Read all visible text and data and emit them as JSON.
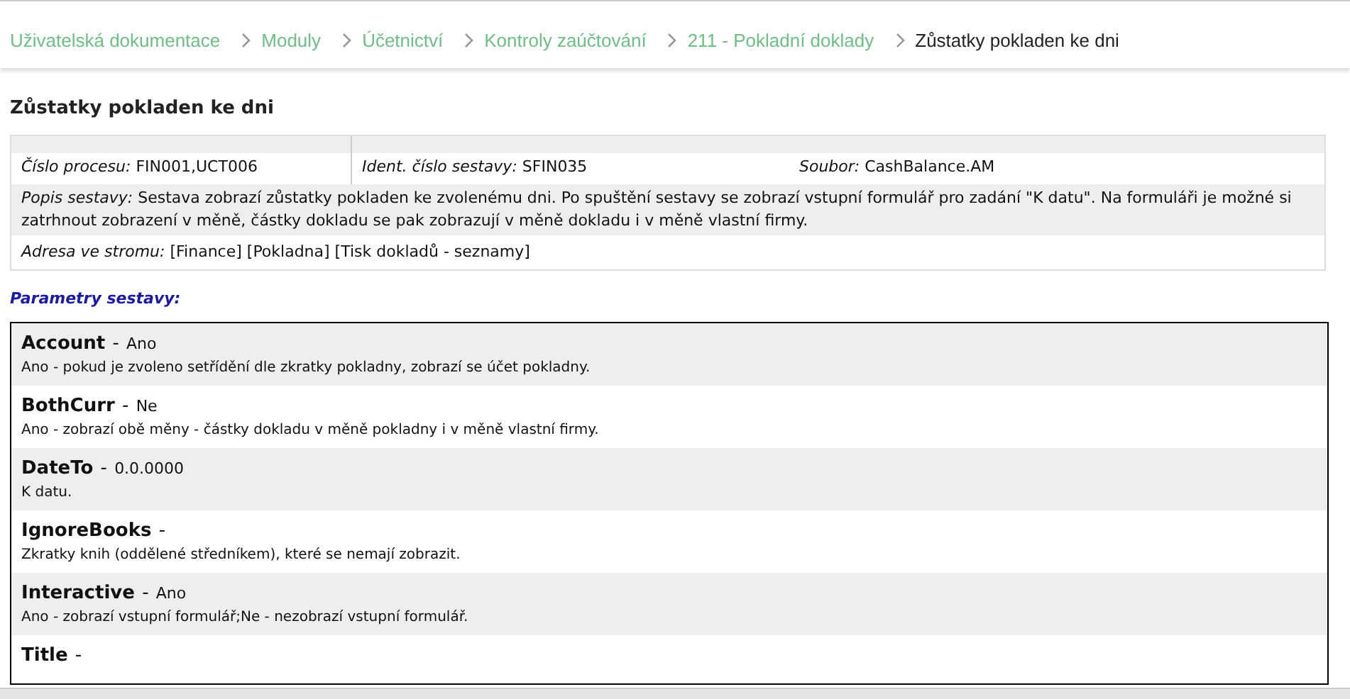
{
  "breadcrumb": [
    {
      "label": "Uživatelská dokumentace",
      "current": false
    },
    {
      "label": "Moduly",
      "current": false
    },
    {
      "label": "Účetnictví",
      "current": false
    },
    {
      "label": "Kontroly zaúčtování",
      "current": false
    },
    {
      "label": "211 - Pokladní doklady",
      "current": false
    },
    {
      "label": "Zůstatky pokladen ke dni",
      "current": true
    }
  ],
  "heading": "Zůstatky pokladen ke dni",
  "info": {
    "process_label": "Číslo procesu:",
    "process_value": "FIN001,UCT006",
    "ident_label": "Ident. číslo sestavy:",
    "ident_value": "SFIN035",
    "file_label": "Soubor:",
    "file_value": "CashBalance.AM",
    "description_label": "Popis sestavy:",
    "description": "Sestava zobrazí zůstatky pokladen ke zvolenému dni. Po spuštění sestavy se zobrazí vstupní formulář pro zadání \"K datu\". Na formuláři je možné si zatrhnout zobrazení v měně, částky dokladu se pak zobrazují v měně dokladu i v měně vlastní firmy.",
    "tree_label": "Adresa ve stromu:",
    "tree_value": "[Finance] [Pokladna] [Tisk dokladů - seznamy]"
  },
  "parameters_heading": "Parametry sestavy:",
  "parameters": [
    {
      "name": "Account",
      "separator": "-",
      "value": "Ano",
      "description": "Ano - pokud je zvoleno setřídění dle zkratky pokladny, zobrazí se účet pokladny."
    },
    {
      "name": "BothCurr",
      "separator": "-",
      "value": "Ne",
      "description": "Ano - zobrazí obě měny - částky dokladu v měně pokladny i v měně vlastní firmy."
    },
    {
      "name": "DateTo",
      "separator": "-",
      "value": "0.0.0000",
      "description": "K datu."
    },
    {
      "name": "IgnoreBooks",
      "separator": "-",
      "description": "Zkratky knih (oddělené středníkem), které se nemají zobrazit."
    },
    {
      "name": "Interactive",
      "separator": "-",
      "value": "Ano",
      "description": "Ano - zobrazí vstupní formulář;Ne - nezobrazí vstupní formulář."
    },
    {
      "name": "Title",
      "separator": "-"
    }
  ]
}
